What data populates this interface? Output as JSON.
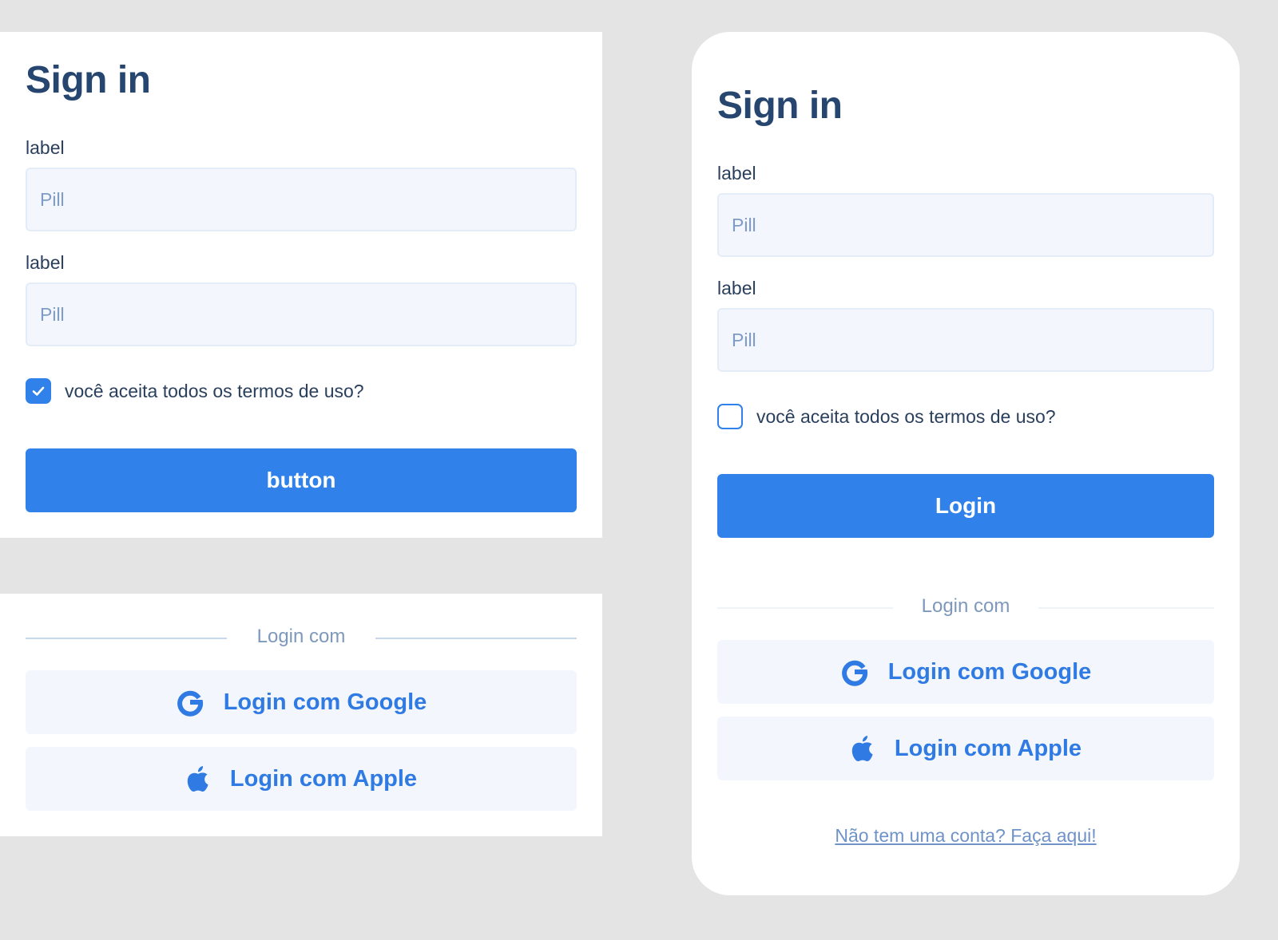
{
  "colors": {
    "background": "#e4e4e4",
    "panel": "#ffffff",
    "title": "#264670",
    "primary": "#3181ea",
    "input_bg": "#f3f7fd",
    "placeholder": "#7e9bc5",
    "social_text": "#2f7ae3",
    "link": "#6f93c8"
  },
  "left_form": {
    "title": "Sign in",
    "fields": [
      {
        "label": "label",
        "placeholder": "Pill",
        "value": ""
      },
      {
        "label": "label",
        "placeholder": "Pill",
        "value": ""
      }
    ],
    "terms": {
      "text": "você aceita todos os termos de uso?",
      "checked": true
    },
    "submit_label": "button"
  },
  "left_social": {
    "divider_text": "Login com",
    "google_label": "Login com Google",
    "apple_label": "Login com Apple",
    "google_icon": "google-icon",
    "apple_icon": "apple-icon"
  },
  "right_card": {
    "title": "Sign in",
    "fields": [
      {
        "label": "label",
        "placeholder": "Pill",
        "value": ""
      },
      {
        "label": "label",
        "placeholder": "Pill",
        "value": ""
      }
    ],
    "terms": {
      "text": "você aceita todos os termos de uso?",
      "checked": false
    },
    "submit_label": "Login",
    "divider_text": "Login com",
    "google_label": "Login com Google",
    "apple_label": "Login com Apple",
    "signup_link": "Não tem uma conta? Faça aqui!"
  }
}
